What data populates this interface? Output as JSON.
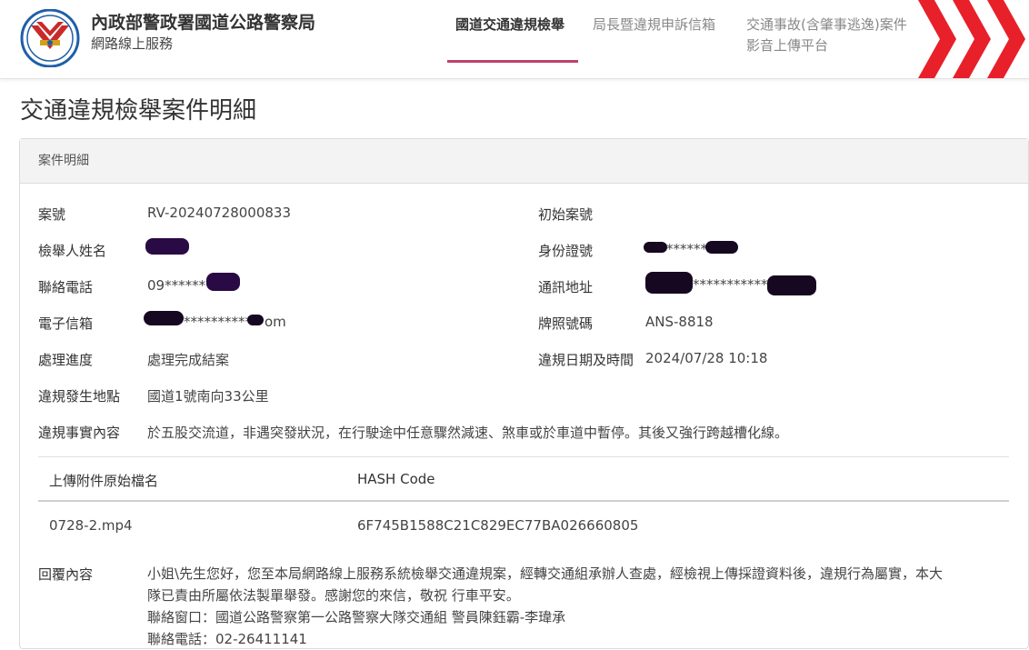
{
  "header": {
    "agency_title": "內政部警政署國道公路警察局",
    "agency_subtitle": "網路線上服務",
    "nav": [
      {
        "label": "國道交通違規檢舉",
        "active": true
      },
      {
        "label": "局長暨違規申訴信箱",
        "active": false
      },
      {
        "label": "交通事故(含肇事逃逸)案件",
        "label2": "影音上傳平台",
        "active": false
      }
    ],
    "accent_color": "#c0406e",
    "chevron_color": "#e8202a"
  },
  "page_title": "交通違規檢舉案件明細",
  "panel_title": "案件明細",
  "fields": {
    "case_no": {
      "label": "案號",
      "value": "RV-20240728000833"
    },
    "orig_case_no": {
      "label": "初始案號",
      "value": ""
    },
    "reporter_name": {
      "label": "檢舉人姓名",
      "value": ""
    },
    "id_no": {
      "label": "身份證號",
      "value": "*******"
    },
    "phone": {
      "label": "聯絡電話",
      "value": "09*******"
    },
    "address": {
      "label": "通訊地址",
      "value": "************"
    },
    "email": {
      "label": "電子信箱",
      "value_mid": "**********",
      "value_end": "om"
    },
    "plate": {
      "label": "牌照號碼",
      "value": "ANS-8818"
    },
    "progress": {
      "label": "處理進度",
      "value": "處理完成結案"
    },
    "datetime": {
      "label": "違規日期及時間",
      "value": "2024/07/28 10:18"
    },
    "location": {
      "label": "違規發生地點",
      "value": "國道1號南向33公里"
    },
    "facts": {
      "label": "違規事實內容",
      "value": "於五股交流道，非遇突發狀況，在行駛途中任意驟然減速、煞車或於車道中暫停。其後又強行跨越槽化線。"
    }
  },
  "attachments": {
    "headers": [
      "上傳附件原始檔名",
      "HASH Code"
    ],
    "rows": [
      [
        "0728-2.mp4",
        "6F745B1588C21C829EC77BA026660805"
      ]
    ]
  },
  "reply": {
    "label": "回覆內容",
    "lines": [
      "小姐\\先生您好，您至本局網路線上服務系統檢舉交通違規案，經轉交通組承辦人查處，經檢視上傳採證資料後，違規行為屬實，本大",
      "隊已責由所屬依法製單舉發。感謝您的來信，敬祝 行車平安。",
      "聯絡窗口：國道公路警察第一公路警察大隊交通組 警員陳鈺霸-李瑋承",
      "聯絡電話：02-26411141"
    ]
  }
}
